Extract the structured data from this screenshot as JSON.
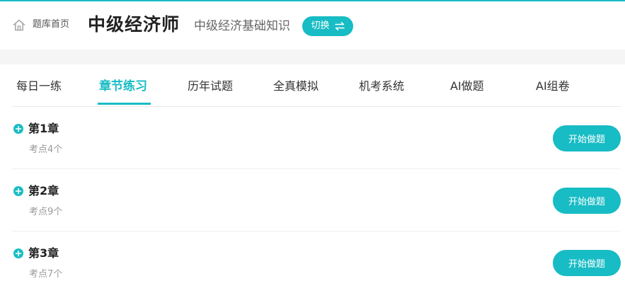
{
  "header": {
    "home_label": "题库首页",
    "home_icon": "home-icon",
    "exam_title": "中级经济师",
    "subject_title": "中级经济基础知识",
    "switch_label": "切换",
    "switch_icon": "swap-arrows-icon"
  },
  "tabs": [
    {
      "label": "每日一练",
      "active": false
    },
    {
      "label": "章节练习",
      "active": true
    },
    {
      "label": "历年试题",
      "active": false
    },
    {
      "label": "全真模拟",
      "active": false
    },
    {
      "label": "机考系统",
      "active": false
    },
    {
      "label": "AI做题",
      "active": false
    },
    {
      "label": "AI组卷",
      "active": false
    }
  ],
  "chapters": [
    {
      "title": "第1章",
      "points": "考点4个",
      "button": "开始做题"
    },
    {
      "title": "第2章",
      "points": "考点9个",
      "button": "开始做题"
    },
    {
      "title": "第3章",
      "points": "考点7个",
      "button": "开始做题"
    }
  ],
  "colors": {
    "accent": "#17bcc4",
    "band": "#f5f5f5",
    "divider": "#eeeeee"
  }
}
